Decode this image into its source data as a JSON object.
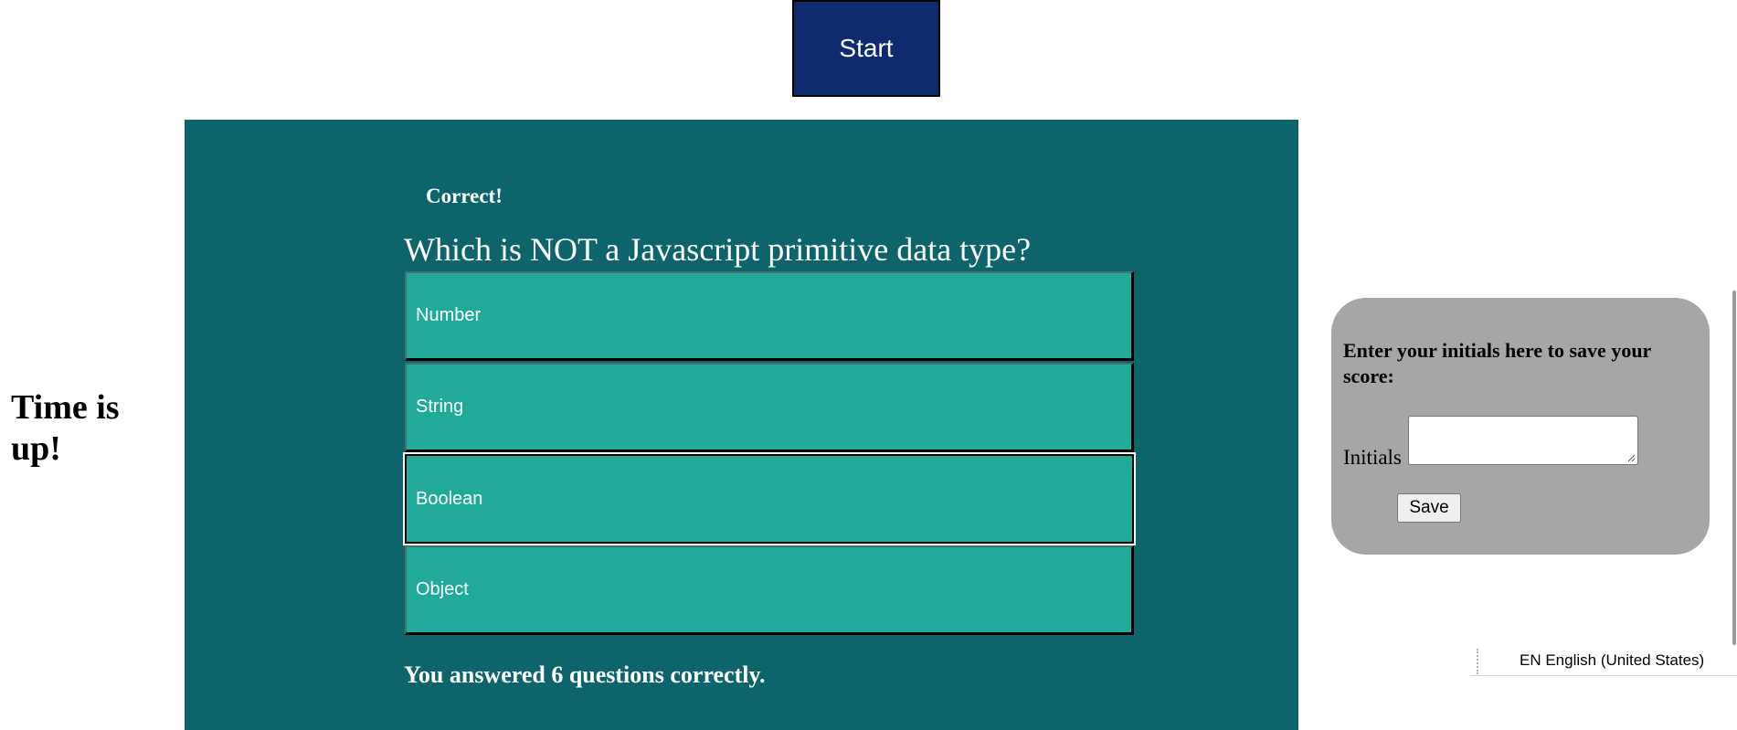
{
  "header": {
    "start_label": "Start"
  },
  "timer": {
    "status_text": "Time is up!"
  },
  "quiz": {
    "feedback": "Correct!",
    "question": "Which is NOT a Javascript primitive data type?",
    "answers": [
      {
        "label": "Number"
      },
      {
        "label": "String"
      },
      {
        "label": "Boolean"
      },
      {
        "label": "Object"
      }
    ],
    "focused_answer": "Boolean",
    "result": "You answered 6 questions correctly."
  },
  "score_form": {
    "prompt": "Enter your initials here to save your score:",
    "initials_label": "Initials",
    "initials_value": "",
    "save_label": "Save"
  },
  "system": {
    "language": "EN English (United States)"
  },
  "colors": {
    "start_button": "#0d2b6e",
    "panel": "#0d646b",
    "answer": "#21a99a",
    "score_card": "#a6a6a6"
  }
}
